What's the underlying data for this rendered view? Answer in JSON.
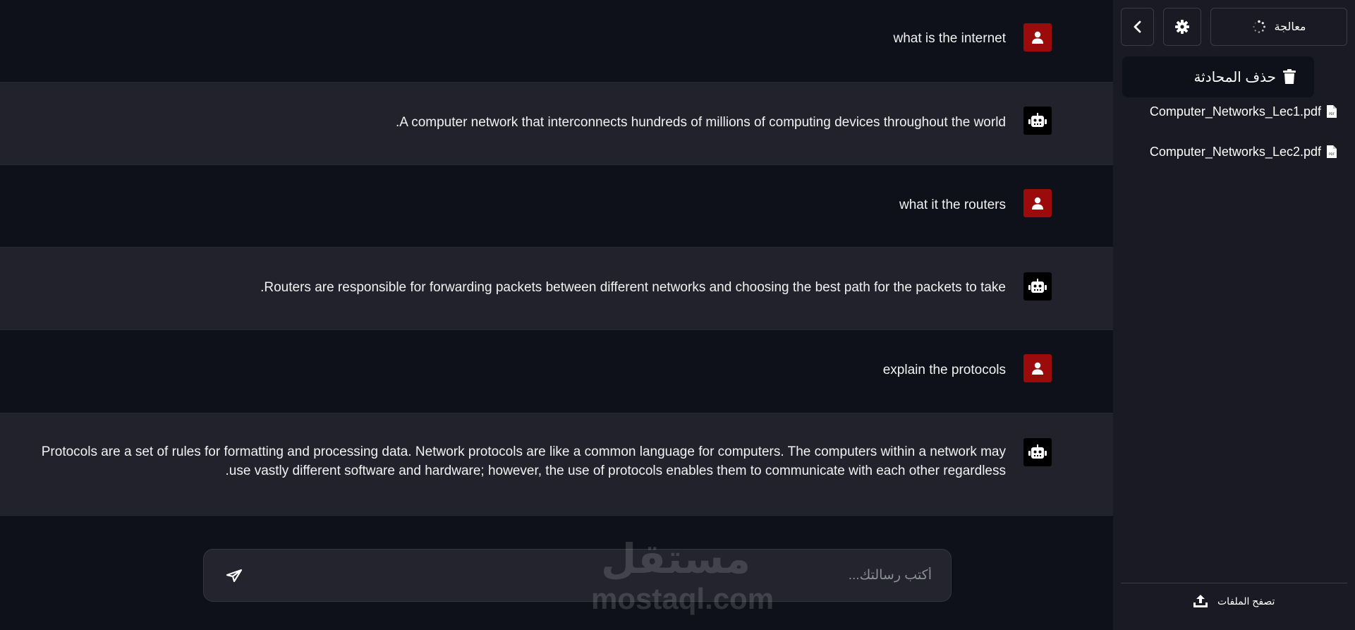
{
  "messages": [
    {
      "role": "user",
      "text": "what is the internet"
    },
    {
      "role": "bot",
      "text": "A computer network that interconnects hundreds of millions of computing devices throughout the world."
    },
    {
      "role": "user",
      "text": "what it the routers"
    },
    {
      "role": "bot",
      "text": "Routers are responsible for forwarding packets between different networks and choosing the best path for the packets to take."
    },
    {
      "role": "user",
      "text": "explain the protocols"
    },
    {
      "role": "bot",
      "text": "Protocols are a set of rules for formatting and processing data. Network protocols are like a common language for computers. The computers within a network may use vastly different software and hardware; however, the use of protocols enables them to communicate with each other regardless."
    }
  ],
  "composer": {
    "placeholder": "أكتب رسالتك..."
  },
  "watermark": {
    "arabic": "مستقل",
    "latin": "mostaql.com"
  },
  "sidebar": {
    "processing_label": "معالجة",
    "delete_chat_label": "حذف المحادثة",
    "files": [
      {
        "name": "Computer_Networks_Lec1.pdf"
      },
      {
        "name": "Computer_Networks_Lec2.pdf"
      }
    ],
    "browse_label": "تصفح الملفات"
  },
  "colors": {
    "chat_bg": "#0f111a",
    "bot_row_bg": "#21222c",
    "sidebar_bg": "#191a23",
    "user_avatar": "#9b0b0b",
    "bot_avatar": "#000000"
  }
}
